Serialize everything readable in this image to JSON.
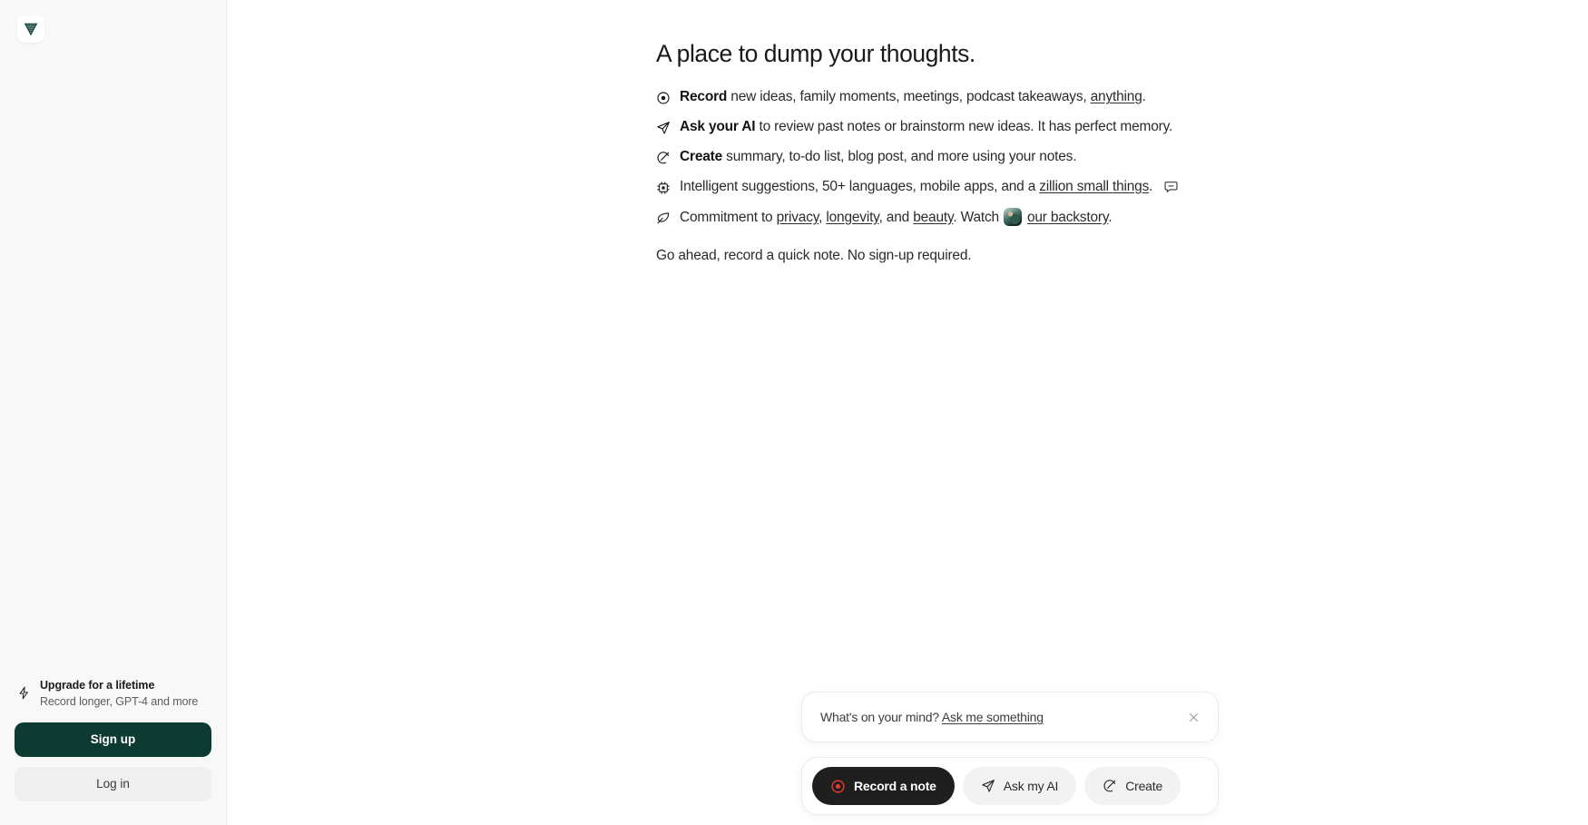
{
  "brand": {
    "logo_icon": "leaf-logo-icon",
    "accent_dark_green": "#0d3b31",
    "accent_record_red": "#e8392a",
    "accent_dark": "#1f1f1f"
  },
  "sidebar": {
    "upgrade": {
      "icon": "lightning-bolt-icon",
      "title": "Upgrade for a lifetime",
      "subtitle": "Record longer, GPT-4 and more"
    },
    "signup_label": "Sign up",
    "login_label": "Log in"
  },
  "main": {
    "headline": "A place to dump your thoughts.",
    "features": [
      {
        "icon": "record-circle-icon",
        "bold": "Record",
        "text_before_link": " new ideas, family moments, meetings, podcast takeaways, ",
        "link": "anything",
        "text_after_link": ".",
        "trailing_icon": ""
      },
      {
        "icon": "paper-plane-icon",
        "bold": "Ask your AI",
        "text_before_link": " to review past notes or brainstorm new ideas. It has perfect memory.",
        "link": "",
        "text_after_link": "",
        "trailing_icon": ""
      },
      {
        "icon": "create-slash-circle-icon",
        "bold": "Create",
        "text_before_link": " summary, to-do list, blog post, and more using your notes.",
        "link": "",
        "text_after_link": "",
        "trailing_icon": ""
      },
      {
        "icon": "cpu-chip-icon",
        "bold": "",
        "text_before_link": "Intelligent suggestions, 50+ languages, mobile apps, and a ",
        "link": "zillion small things",
        "text_after_link": ".",
        "trailing_icon": "speech-bubble-icon"
      }
    ],
    "commitment": {
      "icon": "leaf-icon",
      "prefix": "Commitment to ",
      "link_privacy": "privacy",
      "sep1": ", ",
      "link_longevity": "longevity",
      "sep2": ", and ",
      "link_beauty": "beauty",
      "watch_text": ". Watch",
      "avatar": "founder-avatar",
      "link_backstory": "our backstory",
      "suffix": "."
    },
    "closing": "Go ahead, record a quick note. No sign-up required."
  },
  "composer": {
    "prompt_prefix": "What's on your mind? ",
    "prompt_link": "Ask me something",
    "close_icon": "close-icon",
    "actions": [
      {
        "label": "Record a note",
        "icon": "record-circle-red-icon",
        "style": "primary"
      },
      {
        "label": "Ask my AI",
        "icon": "paper-plane-icon",
        "style": "ghost"
      },
      {
        "label": "Create",
        "icon": "create-slash-circle-icon",
        "style": "ghost"
      }
    ]
  }
}
